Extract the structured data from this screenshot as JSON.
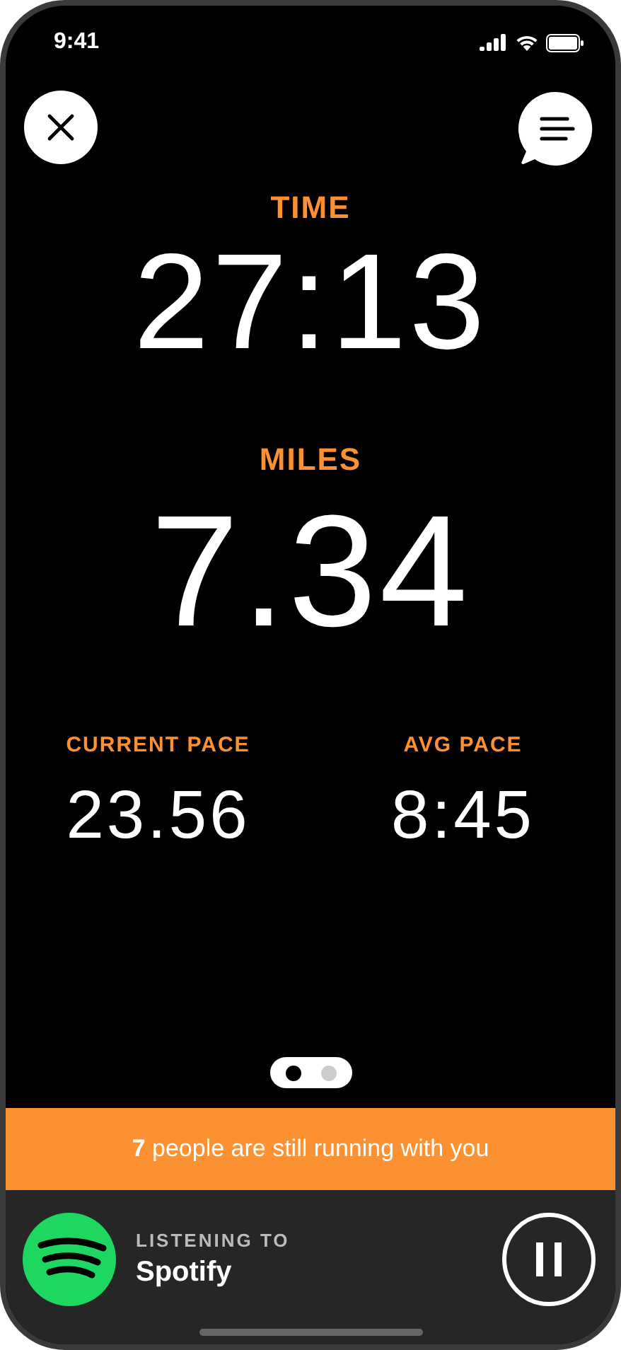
{
  "status_bar": {
    "time": "9:41"
  },
  "stats": [
    {
      "label": "TIME",
      "value": "27:13",
      "kind": "duration"
    },
    {
      "label": "MILES",
      "value": "7.34",
      "kind": "distance"
    }
  ],
  "paces": [
    {
      "label": "CURRENT PACE",
      "value": "23.56"
    },
    {
      "label": "AVG PACE",
      "value": "8:45"
    }
  ],
  "pages": [
    {
      "selected": true
    },
    {
      "selected": false
    }
  ],
  "banner": "**7** people are still running with you",
  "now_playing": {
    "caption": "LISTENING TO",
    "title": "Spotify",
    "playing": true
  }
}
